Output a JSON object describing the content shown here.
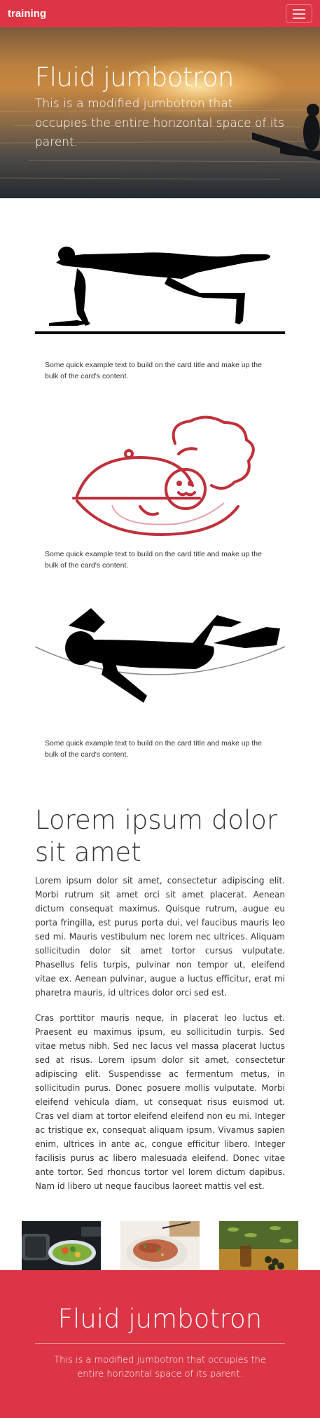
{
  "navbar": {
    "brand": "training",
    "toggle_icon": "hamburger-icon"
  },
  "hero": {
    "title": "Fluid jumbotron",
    "lead": "This is a modified jumbotron that occupies the entire horizontal space of its parent.",
    "image": "sunset-kayak-photo"
  },
  "cards": [
    {
      "image": "plank-exercise-silhouette",
      "text": "Some quick example text to build on the card title and make up the bulk of the card's content."
    },
    {
      "image": "chef-serving-logo",
      "text": "Some quick example text to build on the card title and make up the bulk of the card's content."
    },
    {
      "image": "hammock-rest-silhouette",
      "text": "Some quick example text to build on the card title and make up the bulk of the card's content."
    }
  ],
  "article": {
    "title": "Lorem ipsum dolor sit amet",
    "paragraphs": [
      "Lorem ipsum dolor sit amet, consectetur adipiscing elit. Morbi rutrum sit amet orci sit amet placerat. Aenean dictum consequat maximus. Quisque rutrum, augue eu porta fringilla, est purus porta dui, vel faucibus mauris leo sed mi. Mauris vestibulum nec lorem nec ultrices. Aliquam sollicitudin dolor sit amet tortor cursus vulputate. Phasellus felis turpis, pulvinar non tempor ut, eleifend vitae ex. Aenean pulvinar, augue a luctus efficitur, erat mi pharetra mauris, id ultrices dolor orci sed est.",
      "Cras porttitor mauris neque, in placerat leo luctus et. Praesent eu maximus ipsum, eu sollicitudin turpis. Sed vitae metus nibh. Sed nec lacus vel massa placerat luctus sed at risus. Lorem ipsum dolor sit amet, consectetur adipiscing elit. Suspendisse ac fermentum metus, in sollicitudin purus. Donec posuere mollis vulputate. Morbi eleifend vehicula diam, ut consequat risus euismod ut. Cras vel diam at tortor eleifend eleifend non eu mi. Integer ac tristique ex, consequat aliquam ipsum. Vivamus sapien enim, ultrices in ante ac, congue efficitur libero. Integer facilisis purus ac libero malesuada eleifend. Donec vitae ante tortor. Sed rhoncus tortor vel lorem dictum dapibus. Nam id libero ut neque faucibus laoreet mattis vel est."
    ]
  },
  "thumbnails": [
    {
      "image": "dumbbell-vegetables-photo"
    },
    {
      "image": "grilled-meat-photo"
    },
    {
      "image": "olive-oil-photo"
    }
  ],
  "footer": {
    "title": "Fluid jumbotron",
    "lead": "This is a modified jumbotron that occupies the entire horizontal space of its parent."
  },
  "colors": {
    "accent": "#dc3545",
    "text": "#333333",
    "chef_red": "#c0303a"
  }
}
